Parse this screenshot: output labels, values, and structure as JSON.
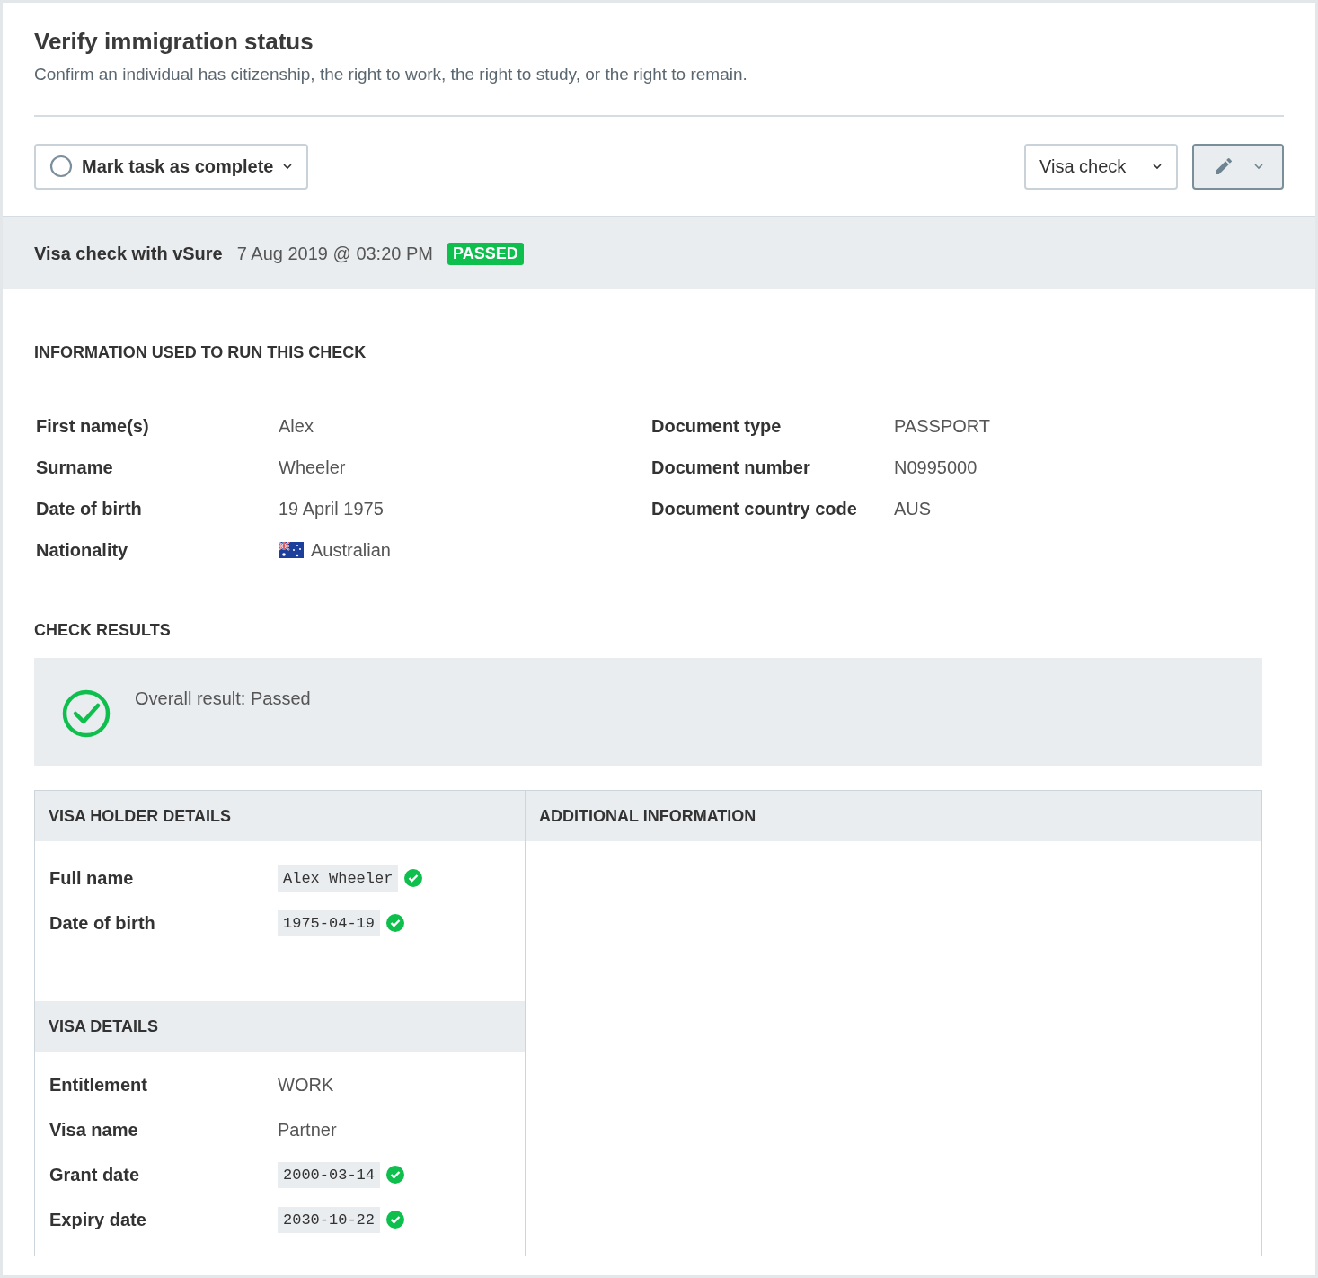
{
  "header": {
    "title": "Verify immigration status",
    "subtitle": "Confirm an individual has citizenship, the right to work, the right to study, or the right to remain."
  },
  "toolbar": {
    "complete_button": {
      "label": "Mark task as complete",
      "checked": false
    },
    "check_type_dropdown": {
      "label": "Visa check"
    }
  },
  "check_header": {
    "title": "Visa check with vSure",
    "timestamp": "7 Aug 2019 @ 03:20 PM",
    "status": "PASSED"
  },
  "information": {
    "heading": "INFORMATION USED TO RUN THIS CHECK",
    "left_fields": [
      {
        "label": "First name(s)",
        "value": "Alex",
        "flag": false
      },
      {
        "label": "Surname",
        "value": "Wheeler",
        "flag": false
      },
      {
        "label": "Date of birth",
        "value": "19 April 1975",
        "flag": false
      },
      {
        "label": "Nationality",
        "value": "Australian",
        "flag": true
      }
    ],
    "right_fields": [
      {
        "label": "Document type",
        "value": "PASSPORT"
      },
      {
        "label": "Document number",
        "value": "N0995000"
      },
      {
        "label": "Document country code",
        "value": "AUS"
      }
    ]
  },
  "results": {
    "heading": "CHECK RESULTS",
    "overall": "Overall result: Passed",
    "passed": true
  },
  "visa_holder_details": {
    "heading": "VISA HOLDER DETAILS",
    "rows": [
      {
        "label": "Full name",
        "value": "Alex Wheeler",
        "kind": "code",
        "verified": true
      },
      {
        "label": "Date of birth",
        "value": "1975-04-19",
        "kind": "code",
        "verified": true
      }
    ]
  },
  "visa_details": {
    "heading": "VISA DETAILS",
    "rows": [
      {
        "label": "Entitlement",
        "value": "WORK",
        "kind": "text",
        "verified": false
      },
      {
        "label": "Visa name",
        "value": "Partner",
        "kind": "text",
        "verified": false
      },
      {
        "label": "Grant date",
        "value": "2000-03-14",
        "kind": "code",
        "verified": true
      },
      {
        "label": "Expiry date",
        "value": "2030-10-22",
        "kind": "code",
        "verified": true
      }
    ]
  },
  "additional_information": {
    "heading": "ADDITIONAL INFORMATION"
  }
}
